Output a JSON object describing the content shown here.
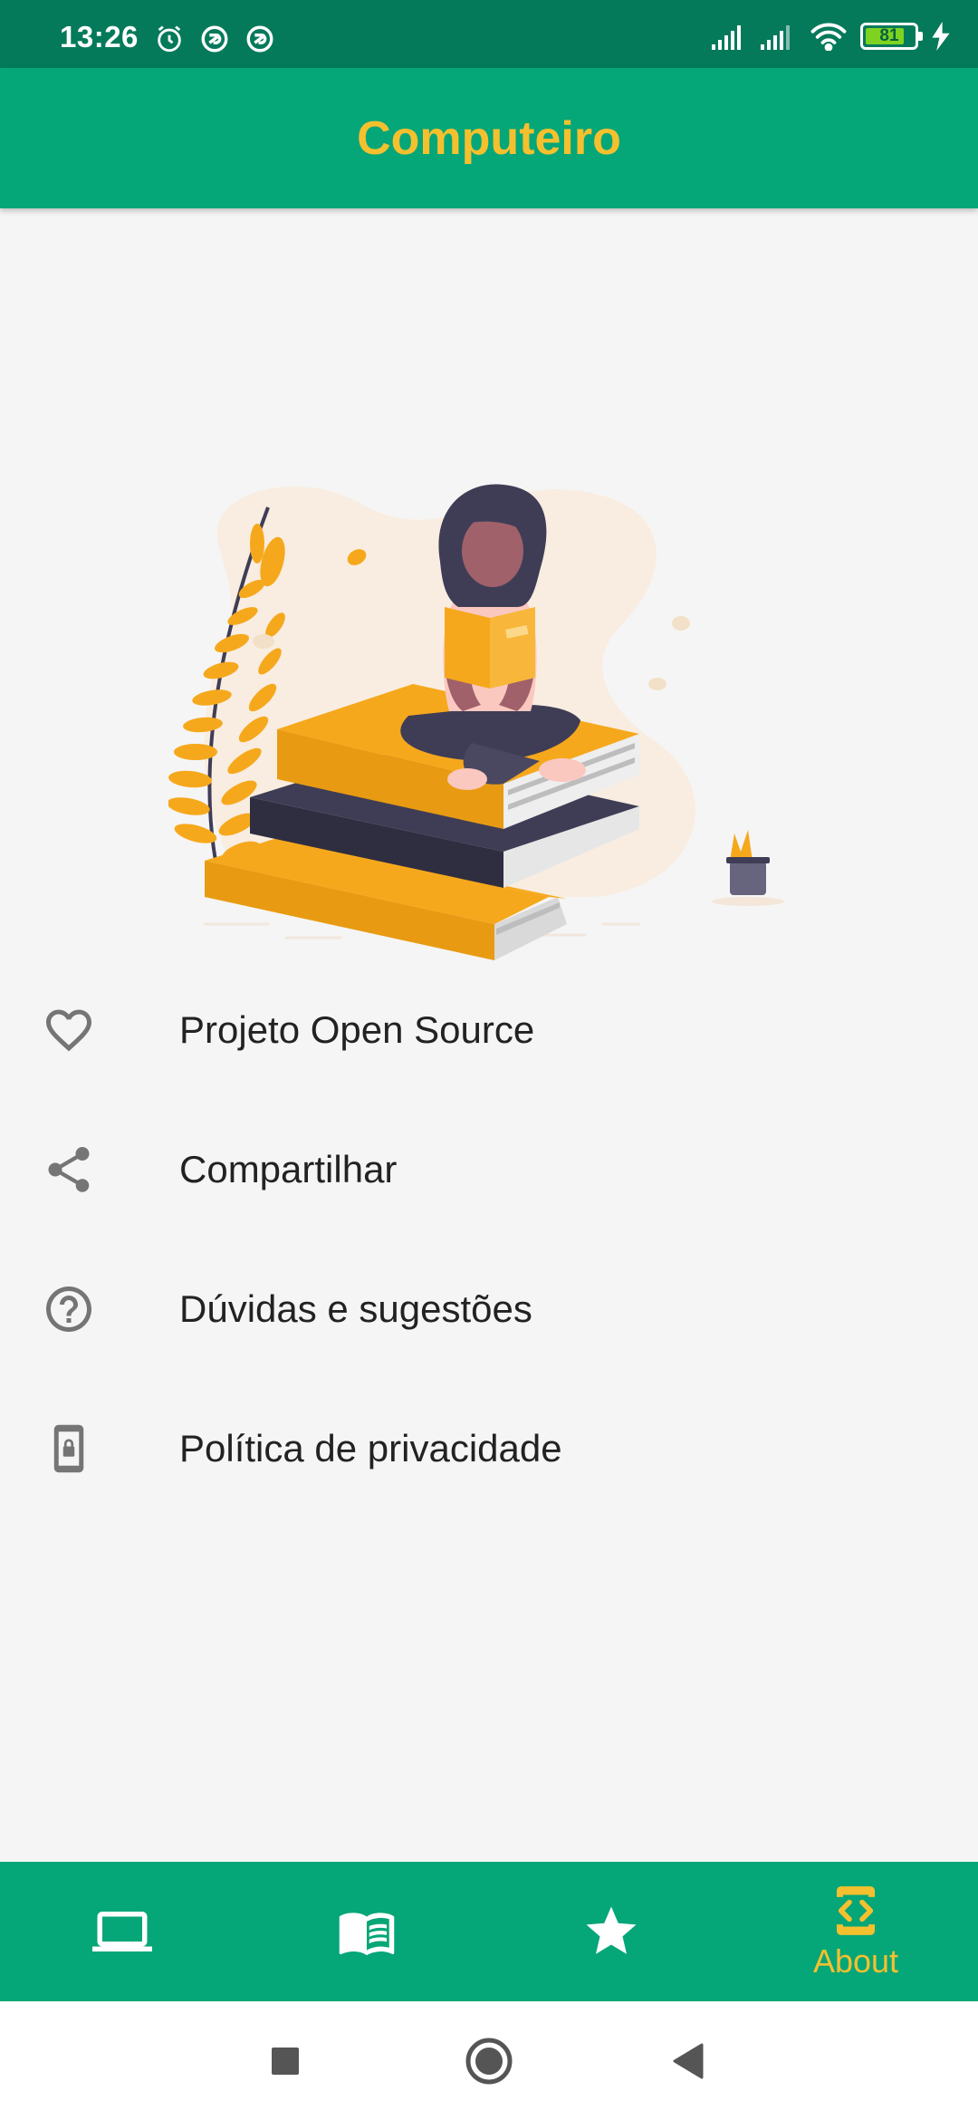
{
  "status_bar": {
    "time": "13:26",
    "battery_level": "81",
    "battery_fraction": 0.81
  },
  "app_bar": {
    "title": "Computeiro"
  },
  "menu": {
    "items": [
      {
        "label": "Projeto Open Source",
        "icon": "heart-outline-icon"
      },
      {
        "label": "Compartilhar",
        "icon": "share-icon"
      },
      {
        "label": "Dúvidas e sugestões",
        "icon": "help-circle-icon"
      },
      {
        "label": "Política de privacidade",
        "icon": "phone-lock-icon"
      }
    ]
  },
  "bottom_nav": {
    "items": [
      {
        "icon": "laptop-icon",
        "label": ""
      },
      {
        "icon": "book-open-icon",
        "label": ""
      },
      {
        "icon": "star-icon",
        "label": ""
      },
      {
        "icon": "code-phone-icon",
        "label": "About",
        "active": true
      }
    ]
  },
  "colors": {
    "status_bar": "#047a5b",
    "primary": "#05a678",
    "accent": "#f5c02e",
    "background": "#f5f5f5",
    "icon_gray": "#757575"
  }
}
